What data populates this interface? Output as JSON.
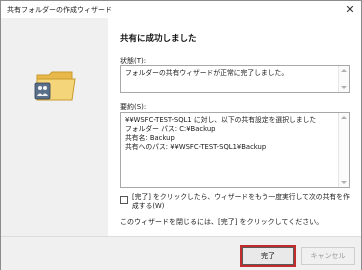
{
  "window": {
    "title": "共有フォルダーの作成ウィザード",
    "close_symbol": "✕"
  },
  "main": {
    "heading": "共有に成功しました",
    "status": {
      "label": "状態(T):",
      "text": "フォルダーの共有ウィザードが正常に完了しました。"
    },
    "summary": {
      "label": "要約(S):",
      "lines": [
        "¥¥WSFC-TEST-SQL1 に対し、以下の共有設定を選択しました",
        "フォルダー パス: C:¥Backup",
        "共有名: Backup",
        "共有へのパス: ¥¥WSFC-TEST-SQL1¥Backup"
      ]
    },
    "rerun_checkbox": {
      "label": "[完了] をクリックしたら、ウィザードをもう一度実行して次の共有を作成する(W)",
      "checked": false
    },
    "close_hint": "このウィザードを閉じるには、[完了] をクリックしてください。"
  },
  "footer": {
    "finish_label": "完了",
    "cancel_label": "キャンセル"
  },
  "colors": {
    "highlight_border": "#c22c2c",
    "folder": "#f2cf6e"
  },
  "icons": {
    "wizard_folder": "folder-share-icon"
  }
}
